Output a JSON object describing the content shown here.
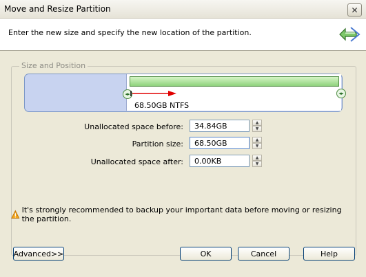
{
  "window": {
    "title": "Move and Resize Partition",
    "close_icon": "close-icon"
  },
  "header": {
    "instruction": "Enter the new size and specify the new location of the partition.",
    "icon": "move-resize-arrows-icon"
  },
  "group": {
    "label": "Size and Position",
    "partition_label": "68.50GB NTFS",
    "colors": {
      "unallocated": "#c8d3f0",
      "partition_fill": "#8fd27d",
      "drag_arrow": "#e00000"
    }
  },
  "fields": [
    {
      "label": "Unallocated space before:",
      "value": "34.84GB"
    },
    {
      "label": "Partition size:",
      "value": "68.50GB"
    },
    {
      "label": "Unallocated space after:",
      "value": "0.00KB"
    }
  ],
  "warning": {
    "text": "It's strongly recommended to backup your important data before moving or resizing the partition.",
    "icon": "warning-icon"
  },
  "buttons": {
    "advanced": "Advanced>>",
    "ok": "OK",
    "cancel": "Cancel",
    "help": "Help"
  }
}
